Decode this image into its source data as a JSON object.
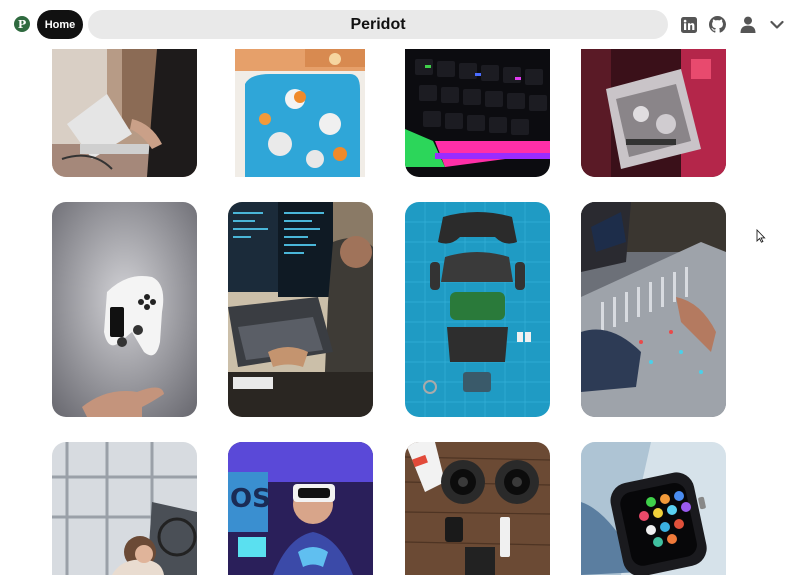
{
  "header": {
    "logo_glyph": "P",
    "home_label": "Home",
    "search_value": "Peridot",
    "icons": [
      "pinterest-logo-icon",
      "linkedin-icon",
      "github-icon",
      "user-icon",
      "chevron-down-icon"
    ]
  },
  "colors": {
    "brand": "#2f6a3f",
    "home_bg": "#111111",
    "search_bg": "#e9e9e9",
    "icon_gray": "#555555"
  },
  "pins": [
    {
      "subject": "person typing on laptop"
    },
    {
      "subject": "bathtub with flowers and oranges"
    },
    {
      "subject": "rgb mechanical keyboard"
    },
    {
      "subject": "graphics card in red light"
    },
    {
      "subject": "white gamepad floating over hand"
    },
    {
      "subject": "programmer at multiple monitors"
    },
    {
      "subject": "disassembled game controller on blue mat"
    },
    {
      "subject": "audio mixing console"
    },
    {
      "subject": "child at robotics lab"
    },
    {
      "subject": "man wearing vr headset"
    },
    {
      "subject": "camera lenses on wooden table"
    },
    {
      "subject": "smartwatch app grid"
    }
  ]
}
